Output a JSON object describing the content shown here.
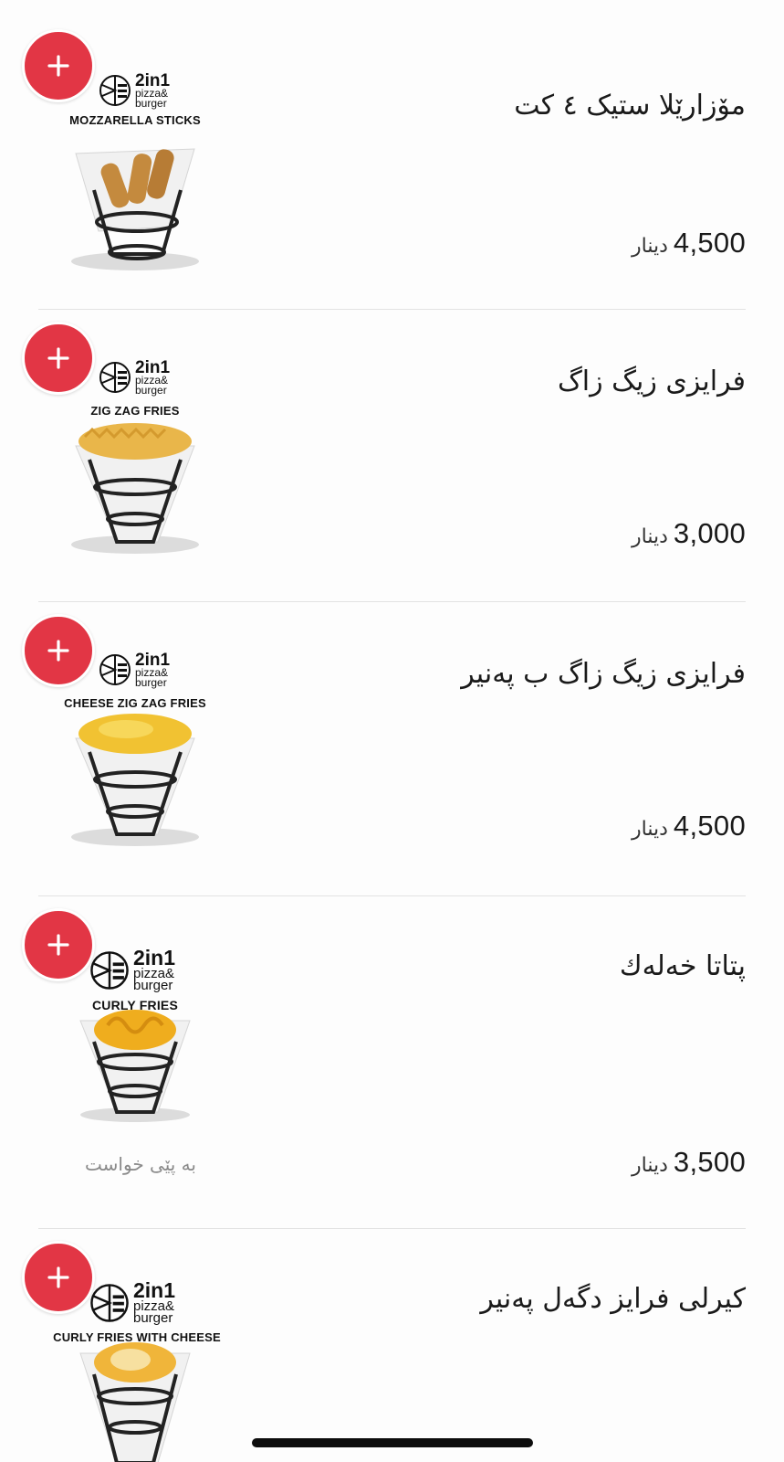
{
  "menu": {
    "items": [
      {
        "name": "مۆزارێلا ستیک ٤ کت",
        "price": "4,500",
        "currency": "دینار",
        "note": "",
        "brand_big": "2in1",
        "brand_small_1": "pizza&",
        "brand_small_2": "burger",
        "caption": "Mozzarella Sticks",
        "food_color": "#c48a3e"
      },
      {
        "name": "فرایزی زیگ زاگ",
        "price": "3,000",
        "currency": "دینار",
        "note": "",
        "brand_big": "2in1",
        "brand_small_1": "pizza&",
        "brand_small_2": "burger",
        "caption": "Zig Zag Fries",
        "food_color": "#e9b64a"
      },
      {
        "name": "فرایزی زیگ زاگ ب پەنیر",
        "price": "4,500",
        "currency": "دینار",
        "note": "",
        "brand_big": "2in1",
        "brand_small_1": "pizza&",
        "brand_small_2": "burger",
        "caption": "Cheese Zig Zag Fries",
        "food_color": "#f1c232"
      },
      {
        "name": "پتاتا خەلەك",
        "price": "3,500",
        "currency": "دینار",
        "note": "بە پێی خواست",
        "brand_big": "2in1",
        "brand_small_1": "pizza&",
        "brand_small_2": "burger",
        "caption": "Curly Fries",
        "food_color": "#efad1e"
      },
      {
        "name": "کیرلی فرایز دگەل پەنیر",
        "price": "",
        "currency": "",
        "note": "",
        "brand_big": "2in1",
        "brand_small_1": "pizza&",
        "brand_small_2": "burger",
        "caption": "Curly Fries with Cheese",
        "food_color": "#f0b53a"
      }
    ]
  },
  "colors": {
    "add_button": "#e23645",
    "divider": "#e2e2e2"
  },
  "icons": {
    "add": "plus-icon"
  }
}
